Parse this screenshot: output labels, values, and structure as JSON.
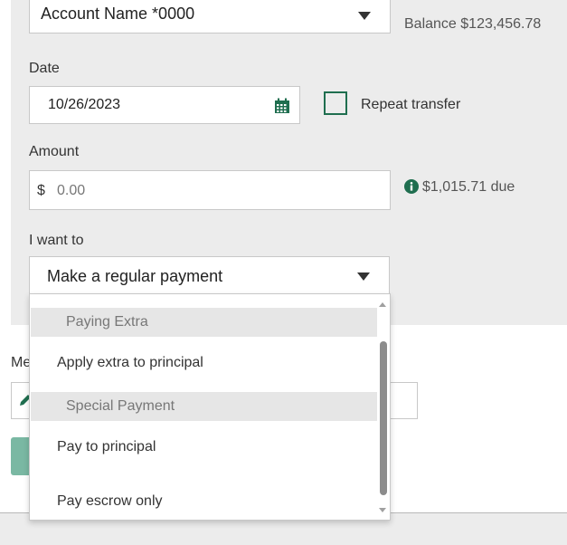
{
  "account": {
    "selected": "Account Name *0000",
    "balance": "Balance $123,456.78"
  },
  "date": {
    "label": "Date",
    "value": "10/26/2023",
    "calendar_icon": "calendar-icon"
  },
  "repeat": {
    "label": "Repeat transfer",
    "checked": false
  },
  "amount": {
    "label": "Amount",
    "currency_symbol": "$",
    "placeholder": "0.00",
    "due_text": "$1,015.71 due",
    "info_icon": "info-icon"
  },
  "intent": {
    "label": "I want to",
    "selected": "Make a regular payment",
    "options": [
      {
        "type": "group",
        "label": "Paying Extra"
      },
      {
        "type": "option",
        "label": "Apply extra to principal"
      },
      {
        "type": "group",
        "label": "Special Payment"
      },
      {
        "type": "option",
        "label": "Pay to principal"
      },
      {
        "type": "option",
        "label": "Pay escrow only"
      }
    ]
  },
  "memo": {
    "label_partial": "Me",
    "edit_icon": "pencil-icon"
  },
  "colors": {
    "accent_green": "#1f6e4f",
    "panel_bg": "#ececec",
    "submit_partial": "#7ab8a3"
  }
}
